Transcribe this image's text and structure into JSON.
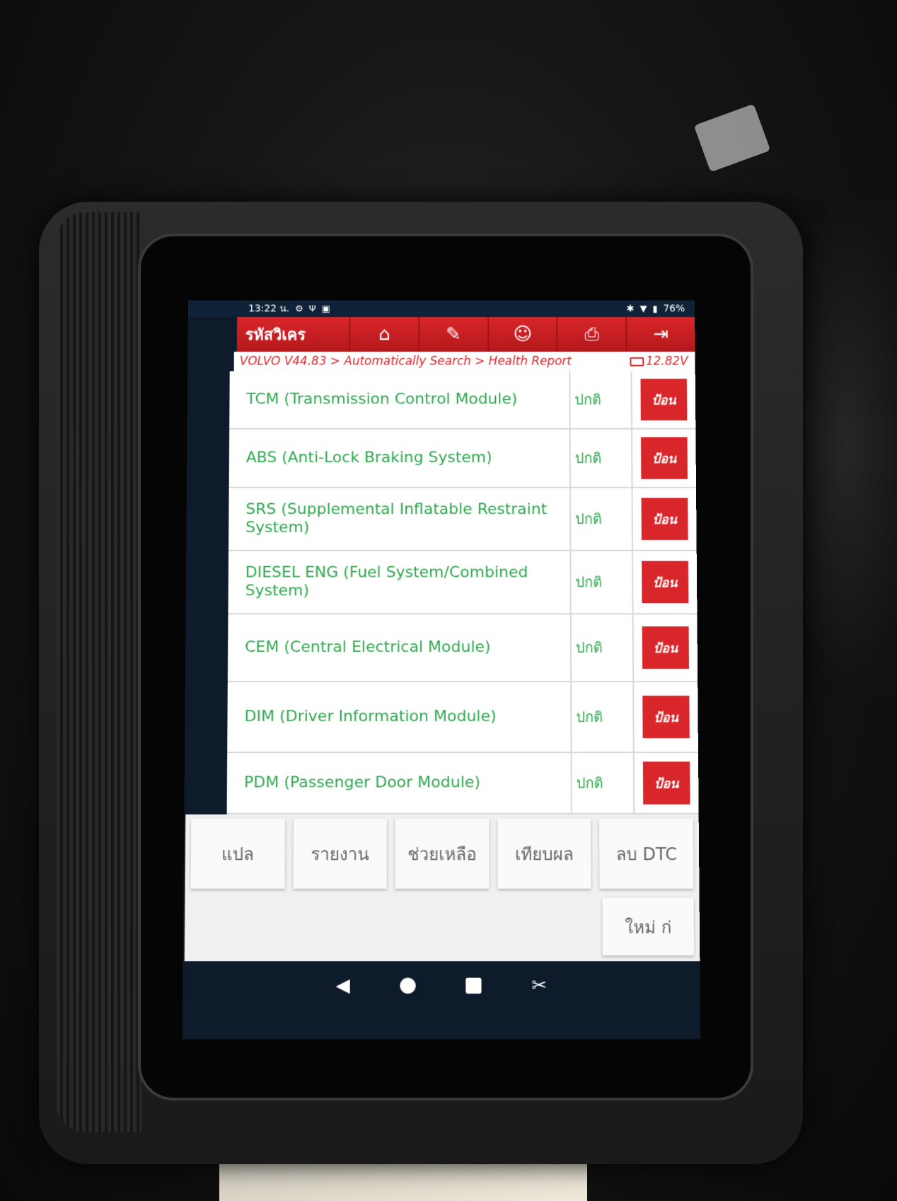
{
  "status_bar": {
    "time": "13:22 น.",
    "battery": "76%"
  },
  "header": {
    "title": "รหัสวิเคร",
    "buttons": [
      {
        "icon": "home-icon",
        "glyph": "⌂"
      },
      {
        "icon": "edit-icon",
        "glyph": "✎"
      },
      {
        "icon": "user-icon",
        "glyph": "☺"
      },
      {
        "icon": "print-icon",
        "glyph": "⎙"
      },
      {
        "icon": "exit-icon",
        "glyph": "⇥"
      }
    ]
  },
  "breadcrumb": {
    "path": "VOLVO V44.83 > Automatically Search > Health Report",
    "voltage": "12.82V"
  },
  "modules": [
    {
      "name": "TCM (Transmission Control Module)",
      "status": "ปกติ",
      "action": "ป้อน"
    },
    {
      "name": "ABS (Anti-Lock Braking System)",
      "status": "ปกติ",
      "action": "ป้อน"
    },
    {
      "name": "SRS (Supplemental Inflatable Restraint System)",
      "status": "ปกติ",
      "action": "ป้อน"
    },
    {
      "name": "DIESEL ENG (Fuel System/Combined System)",
      "status": "ปกติ",
      "action": "ป้อน"
    },
    {
      "name": "CEM (Central Electrical Module)",
      "status": "ปกติ",
      "action": "ป้อน"
    },
    {
      "name": "DIM (Driver Information Module)",
      "status": "ปกติ",
      "action": "ป้อน"
    },
    {
      "name": "PDM (Passenger Door Module)",
      "status": "ปกติ",
      "action": "ป้อน"
    }
  ],
  "toolbar": {
    "translate": "แปล",
    "report": "รายงาน",
    "help": "ช่วยเหลือ",
    "compare": "เทียบผล",
    "clear_dtc": "ลบ DTC",
    "new": "ใหม่  ก่"
  }
}
